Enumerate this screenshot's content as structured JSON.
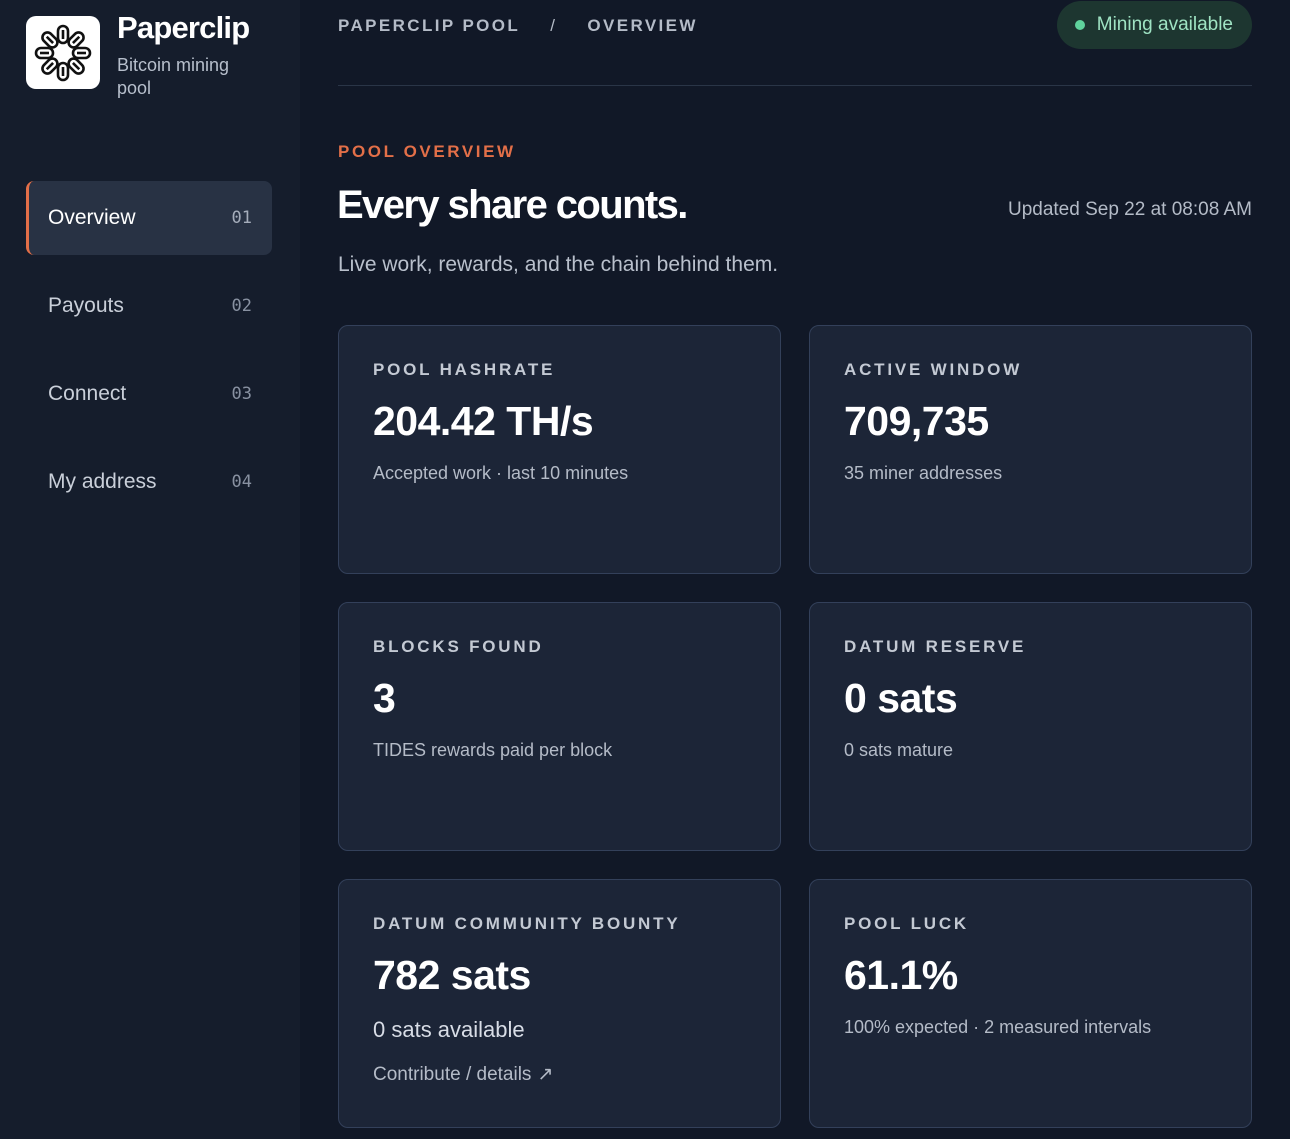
{
  "brand": {
    "name": "Paperclip",
    "subtitle": "Bitcoin mining pool"
  },
  "nav": [
    {
      "label": "Overview",
      "num": "01",
      "active": true
    },
    {
      "label": "Payouts",
      "num": "02"
    },
    {
      "label": "Connect",
      "num": "03"
    },
    {
      "label": "My address",
      "num": "04"
    }
  ],
  "breadcrumb": {
    "root": "PAPERCLIP POOL",
    "sep": "/",
    "current": "OVERVIEW"
  },
  "status": {
    "label": "Mining available",
    "color": "#5fd39c"
  },
  "header": {
    "eyebrow": "POOL OVERVIEW",
    "headline": "Every share counts.",
    "updated": "Updated Sep 22 at 08:08 AM",
    "lede": "Live work, rewards, and the chain behind them."
  },
  "cards": {
    "hashrate": {
      "title": "POOL HASHRATE",
      "value": "204.42 TH/s",
      "sub": "Accepted work · last 10 minutes"
    },
    "window": {
      "title": "ACTIVE WINDOW",
      "value": "709,735",
      "sub": "35 miner addresses"
    },
    "blocks": {
      "title": "BLOCKS FOUND",
      "value": "3",
      "sub": "TIDES rewards paid per block"
    },
    "reserve": {
      "title": "DATUM RESERVE",
      "value": "0 sats",
      "sub": "0 sats mature"
    },
    "bounty": {
      "title": "DATUM COMMUNITY BOUNTY",
      "value": "782 sats",
      "sub": "0 sats available",
      "link": "Contribute / details",
      "link_icon": "↗"
    },
    "luck": {
      "title": "POOL LUCK",
      "value": "61.1%",
      "sub": "100% expected · 2 measured intervals"
    }
  },
  "colors": {
    "accent": "#e36f48",
    "background": "#111827",
    "sidebar": "#151d2c",
    "card": "#1c2537"
  }
}
